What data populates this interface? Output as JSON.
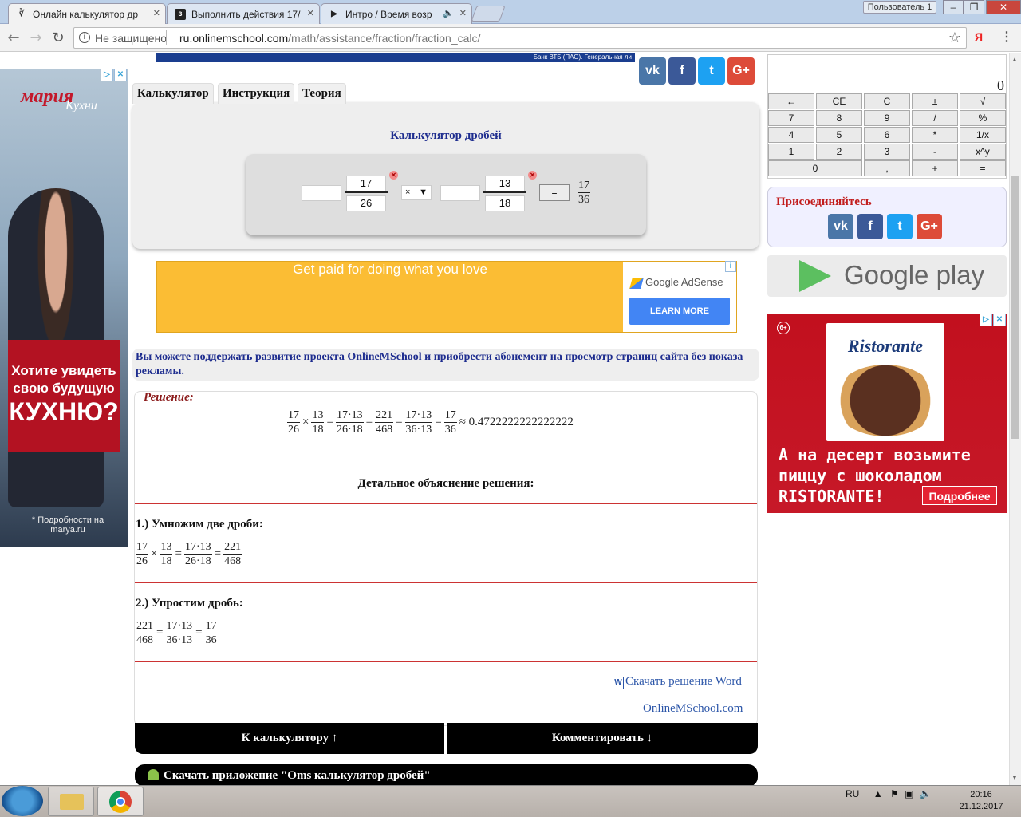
{
  "browser": {
    "tabs": [
      {
        "title": "Онлайн калькулятор др",
        "icon": "onlinemschool-favicon"
      },
      {
        "title": "Выполнить действия 17/",
        "icon": "z-favicon"
      },
      {
        "title": "Интро / Время возр",
        "icon": "play-favicon"
      }
    ],
    "user_label": "Пользователь 1",
    "security_label": "Не защищено",
    "url_host": "ru.onlinemschool.com",
    "url_path": "/math/assistance/fraction/fraction_calc/"
  },
  "page": {
    "top_banner": "Банк ВТБ (ПАО). Генеральная ли",
    "tabs": [
      "Калькулятор",
      "Инструкция",
      "Теория"
    ],
    "calc_title": "Калькулятор дробей",
    "calc": {
      "f1_whole": "",
      "f1_num": "17",
      "f1_den": "26",
      "op": "×",
      "f2_whole": "",
      "f2_num": "13",
      "f2_den": "18",
      "eq_label": "=",
      "res_num": "17",
      "res_den": "36"
    },
    "google_ad": {
      "text": "Get paid for doing what you love",
      "brand": "Google AdSense",
      "button": "LEARN MORE"
    },
    "support_text": "Вы можете поддержать развитие проекта OnlineMSchool и приобрести абонемент на просмотр страниц сайта без показа рекламы.",
    "solution": {
      "title": "Решение:",
      "main_chain": {
        "f1": [
          "17",
          "26"
        ],
        "f2": [
          "13",
          "18"
        ],
        "f3": [
          "17·13",
          "26·18"
        ],
        "f4": [
          "221",
          "468"
        ],
        "f5": [
          "17·13",
          "36·13"
        ],
        "f6": [
          "17",
          "36"
        ],
        "approx": "≈ 0.4722222222222222"
      },
      "detail_title": "Детальное объяснение решения:",
      "step1_title": "1.) Умножим две дроби:",
      "step1": {
        "f1": [
          "17",
          "26"
        ],
        "f2": [
          "13",
          "18"
        ],
        "f3": [
          "17·13",
          "26·18"
        ],
        "f4": [
          "221",
          "468"
        ]
      },
      "step2_title": "2.) Упростим дробь:",
      "step2": {
        "f1": [
          "221",
          "468"
        ],
        "f2": [
          "17·13",
          "36·13"
        ],
        "f3": [
          "17",
          "36"
        ]
      },
      "word_link": "Скачать решение Word",
      "site_link": "OnlineMSchool.com"
    },
    "btn_to_calc": "К калькулятору ↑",
    "btn_comment": "Комментировать ↓",
    "app_btn": "Скачать приложение \"Oms калькулятор дробей\"",
    "left_ad": {
      "brand": "мария",
      "brand2": "Кухни",
      "headline1": "Хотите увидеть",
      "headline2": "свою будущую",
      "headline3": "КУХНЮ?",
      "note": "* Подробности на marya.ru"
    },
    "right_calc": {
      "display": "0",
      "keys": [
        [
          "←",
          "CE",
          "C",
          "±",
          "√"
        ],
        [
          "7",
          "8",
          "9",
          "/",
          "%"
        ],
        [
          "4",
          "5",
          "6",
          "*",
          "1/x"
        ],
        [
          "1",
          "2",
          "3",
          "-",
          "x^y"
        ],
        [
          "0",
          ",",
          "+",
          "="
        ]
      ]
    },
    "join_title": "Присоединяйтесь",
    "google_play": "Google play",
    "pizza_ad": {
      "age": "6+",
      "brand": "Ristorante",
      "line1": "А на десерт возьмите",
      "line2": "пиццу с шоколадом",
      "line3": "RISTORANTE!",
      "more": "Подробнее"
    }
  },
  "taskbar": {
    "lang": "RU",
    "time": "20:16",
    "date": "21.12.2017"
  }
}
